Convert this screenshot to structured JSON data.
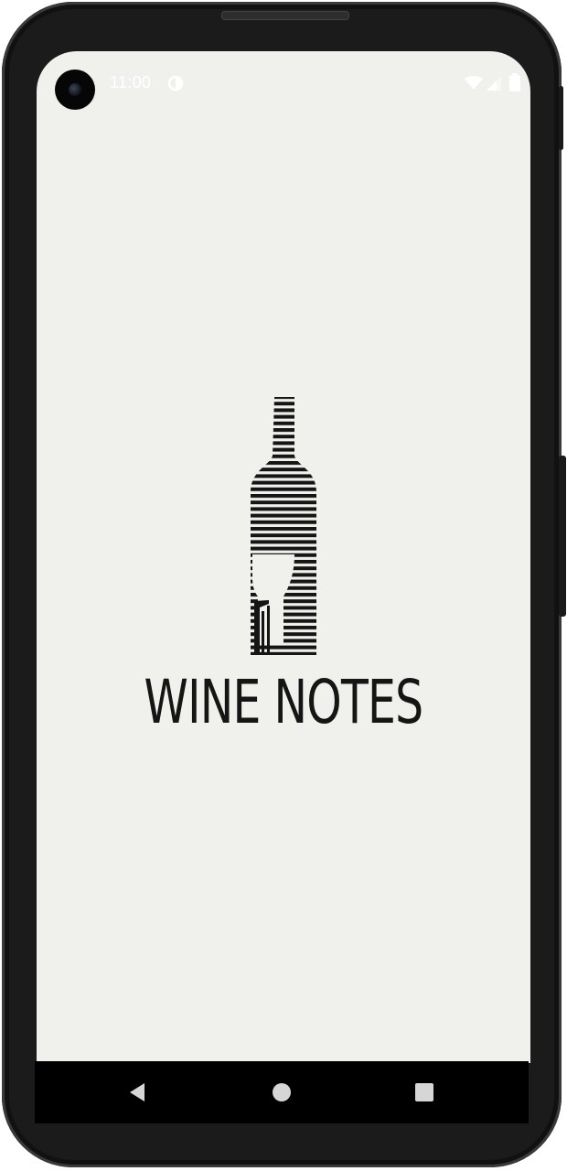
{
  "status_bar": {
    "time": "11:00",
    "icons": [
      "data-saver-icon",
      "wifi-icon",
      "signal-icon",
      "battery-icon"
    ]
  },
  "app": {
    "title": "WINE NOTES",
    "logo_icon": "wine-bottle-glass-logo"
  },
  "navigation_bar": {
    "buttons": [
      "back-icon",
      "home-icon",
      "recents-icon"
    ]
  },
  "colors": {
    "screen_background": "#f0f0ed",
    "logo": "#151515",
    "frame": "#1b1b1b"
  }
}
